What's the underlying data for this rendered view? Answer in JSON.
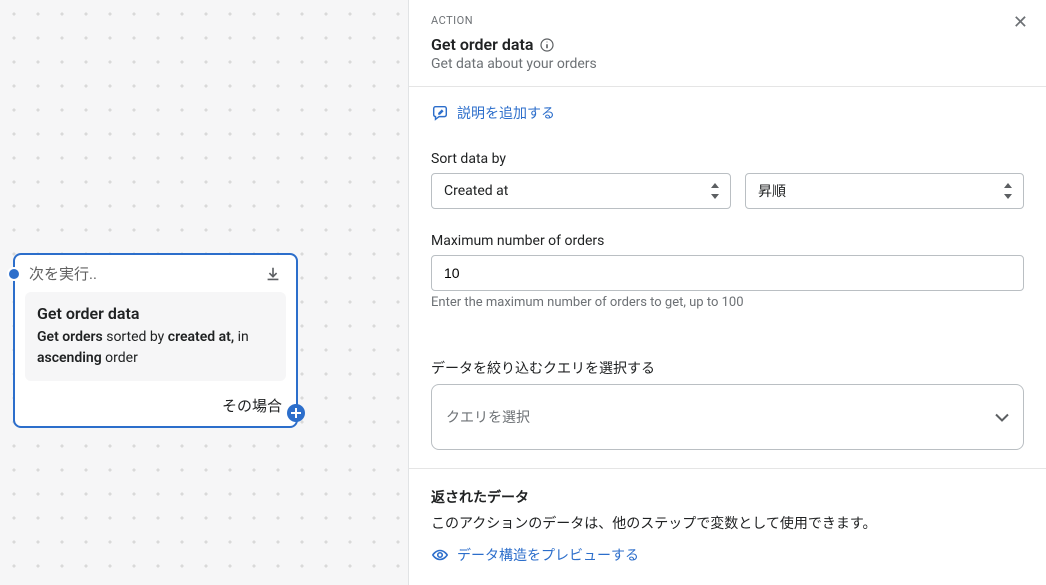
{
  "canvas": {
    "node_header": "次を実行..",
    "node_title": "Get order data",
    "node_desc_1": "Get orders",
    "node_desc_2": " sorted by ",
    "node_desc_3": "created at,",
    "node_desc_4": " in ",
    "node_desc_5": "ascending",
    "node_desc_6": " order",
    "node_footer": "その場合"
  },
  "panel": {
    "label": "ACTION",
    "title": "Get order data",
    "subtitle": "Get data about your orders",
    "add_description": "説明を追加する",
    "sort_label": "Sort data by",
    "sort_field": "Created at",
    "sort_direction": "昇順",
    "max_label": "Maximum number of orders",
    "max_value": "10",
    "max_help": "Enter the maximum number of orders to get, up to 100",
    "query_label": "データを絞り込むクエリを選択する",
    "query_placeholder": "クエリを選択",
    "returned_title": "返されたデータ",
    "returned_desc": "このアクションのデータは、他のステップで変数として使用できます。",
    "preview_link": "データ構造をプレビューする"
  }
}
